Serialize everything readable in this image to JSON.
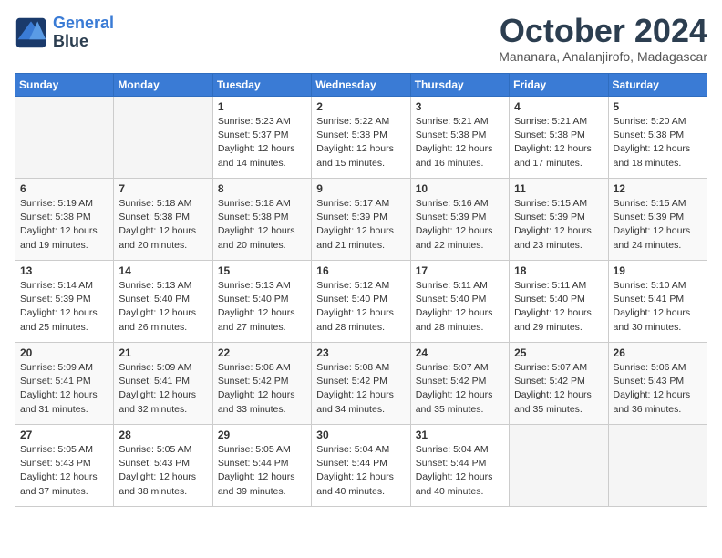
{
  "header": {
    "logo_line1": "General",
    "logo_line2": "Blue",
    "month_title": "October 2024",
    "location": "Mananara, Analanjirofo, Madagascar"
  },
  "weekdays": [
    "Sunday",
    "Monday",
    "Tuesday",
    "Wednesday",
    "Thursday",
    "Friday",
    "Saturday"
  ],
  "weeks": [
    [
      {
        "day": "",
        "sunrise": "",
        "sunset": "",
        "daylight": ""
      },
      {
        "day": "",
        "sunrise": "",
        "sunset": "",
        "daylight": ""
      },
      {
        "day": "1",
        "sunrise": "Sunrise: 5:23 AM",
        "sunset": "Sunset: 5:37 PM",
        "daylight": "Daylight: 12 hours and 14 minutes."
      },
      {
        "day": "2",
        "sunrise": "Sunrise: 5:22 AM",
        "sunset": "Sunset: 5:38 PM",
        "daylight": "Daylight: 12 hours and 15 minutes."
      },
      {
        "day": "3",
        "sunrise": "Sunrise: 5:21 AM",
        "sunset": "Sunset: 5:38 PM",
        "daylight": "Daylight: 12 hours and 16 minutes."
      },
      {
        "day": "4",
        "sunrise": "Sunrise: 5:21 AM",
        "sunset": "Sunset: 5:38 PM",
        "daylight": "Daylight: 12 hours and 17 minutes."
      },
      {
        "day": "5",
        "sunrise": "Sunrise: 5:20 AM",
        "sunset": "Sunset: 5:38 PM",
        "daylight": "Daylight: 12 hours and 18 minutes."
      }
    ],
    [
      {
        "day": "6",
        "sunrise": "Sunrise: 5:19 AM",
        "sunset": "Sunset: 5:38 PM",
        "daylight": "Daylight: 12 hours and 19 minutes."
      },
      {
        "day": "7",
        "sunrise": "Sunrise: 5:18 AM",
        "sunset": "Sunset: 5:38 PM",
        "daylight": "Daylight: 12 hours and 20 minutes."
      },
      {
        "day": "8",
        "sunrise": "Sunrise: 5:18 AM",
        "sunset": "Sunset: 5:38 PM",
        "daylight": "Daylight: 12 hours and 20 minutes."
      },
      {
        "day": "9",
        "sunrise": "Sunrise: 5:17 AM",
        "sunset": "Sunset: 5:39 PM",
        "daylight": "Daylight: 12 hours and 21 minutes."
      },
      {
        "day": "10",
        "sunrise": "Sunrise: 5:16 AM",
        "sunset": "Sunset: 5:39 PM",
        "daylight": "Daylight: 12 hours and 22 minutes."
      },
      {
        "day": "11",
        "sunrise": "Sunrise: 5:15 AM",
        "sunset": "Sunset: 5:39 PM",
        "daylight": "Daylight: 12 hours and 23 minutes."
      },
      {
        "day": "12",
        "sunrise": "Sunrise: 5:15 AM",
        "sunset": "Sunset: 5:39 PM",
        "daylight": "Daylight: 12 hours and 24 minutes."
      }
    ],
    [
      {
        "day": "13",
        "sunrise": "Sunrise: 5:14 AM",
        "sunset": "Sunset: 5:39 PM",
        "daylight": "Daylight: 12 hours and 25 minutes."
      },
      {
        "day": "14",
        "sunrise": "Sunrise: 5:13 AM",
        "sunset": "Sunset: 5:40 PM",
        "daylight": "Daylight: 12 hours and 26 minutes."
      },
      {
        "day": "15",
        "sunrise": "Sunrise: 5:13 AM",
        "sunset": "Sunset: 5:40 PM",
        "daylight": "Daylight: 12 hours and 27 minutes."
      },
      {
        "day": "16",
        "sunrise": "Sunrise: 5:12 AM",
        "sunset": "Sunset: 5:40 PM",
        "daylight": "Daylight: 12 hours and 28 minutes."
      },
      {
        "day": "17",
        "sunrise": "Sunrise: 5:11 AM",
        "sunset": "Sunset: 5:40 PM",
        "daylight": "Daylight: 12 hours and 28 minutes."
      },
      {
        "day": "18",
        "sunrise": "Sunrise: 5:11 AM",
        "sunset": "Sunset: 5:40 PM",
        "daylight": "Daylight: 12 hours and 29 minutes."
      },
      {
        "day": "19",
        "sunrise": "Sunrise: 5:10 AM",
        "sunset": "Sunset: 5:41 PM",
        "daylight": "Daylight: 12 hours and 30 minutes."
      }
    ],
    [
      {
        "day": "20",
        "sunrise": "Sunrise: 5:09 AM",
        "sunset": "Sunset: 5:41 PM",
        "daylight": "Daylight: 12 hours and 31 minutes."
      },
      {
        "day": "21",
        "sunrise": "Sunrise: 5:09 AM",
        "sunset": "Sunset: 5:41 PM",
        "daylight": "Daylight: 12 hours and 32 minutes."
      },
      {
        "day": "22",
        "sunrise": "Sunrise: 5:08 AM",
        "sunset": "Sunset: 5:42 PM",
        "daylight": "Daylight: 12 hours and 33 minutes."
      },
      {
        "day": "23",
        "sunrise": "Sunrise: 5:08 AM",
        "sunset": "Sunset: 5:42 PM",
        "daylight": "Daylight: 12 hours and 34 minutes."
      },
      {
        "day": "24",
        "sunrise": "Sunrise: 5:07 AM",
        "sunset": "Sunset: 5:42 PM",
        "daylight": "Daylight: 12 hours and 35 minutes."
      },
      {
        "day": "25",
        "sunrise": "Sunrise: 5:07 AM",
        "sunset": "Sunset: 5:42 PM",
        "daylight": "Daylight: 12 hours and 35 minutes."
      },
      {
        "day": "26",
        "sunrise": "Sunrise: 5:06 AM",
        "sunset": "Sunset: 5:43 PM",
        "daylight": "Daylight: 12 hours and 36 minutes."
      }
    ],
    [
      {
        "day": "27",
        "sunrise": "Sunrise: 5:05 AM",
        "sunset": "Sunset: 5:43 PM",
        "daylight": "Daylight: 12 hours and 37 minutes."
      },
      {
        "day": "28",
        "sunrise": "Sunrise: 5:05 AM",
        "sunset": "Sunset: 5:43 PM",
        "daylight": "Daylight: 12 hours and 38 minutes."
      },
      {
        "day": "29",
        "sunrise": "Sunrise: 5:05 AM",
        "sunset": "Sunset: 5:44 PM",
        "daylight": "Daylight: 12 hours and 39 minutes."
      },
      {
        "day": "30",
        "sunrise": "Sunrise: 5:04 AM",
        "sunset": "Sunset: 5:44 PM",
        "daylight": "Daylight: 12 hours and 40 minutes."
      },
      {
        "day": "31",
        "sunrise": "Sunrise: 5:04 AM",
        "sunset": "Sunset: 5:44 PM",
        "daylight": "Daylight: 12 hours and 40 minutes."
      },
      {
        "day": "",
        "sunrise": "",
        "sunset": "",
        "daylight": ""
      },
      {
        "day": "",
        "sunrise": "",
        "sunset": "",
        "daylight": ""
      }
    ]
  ]
}
